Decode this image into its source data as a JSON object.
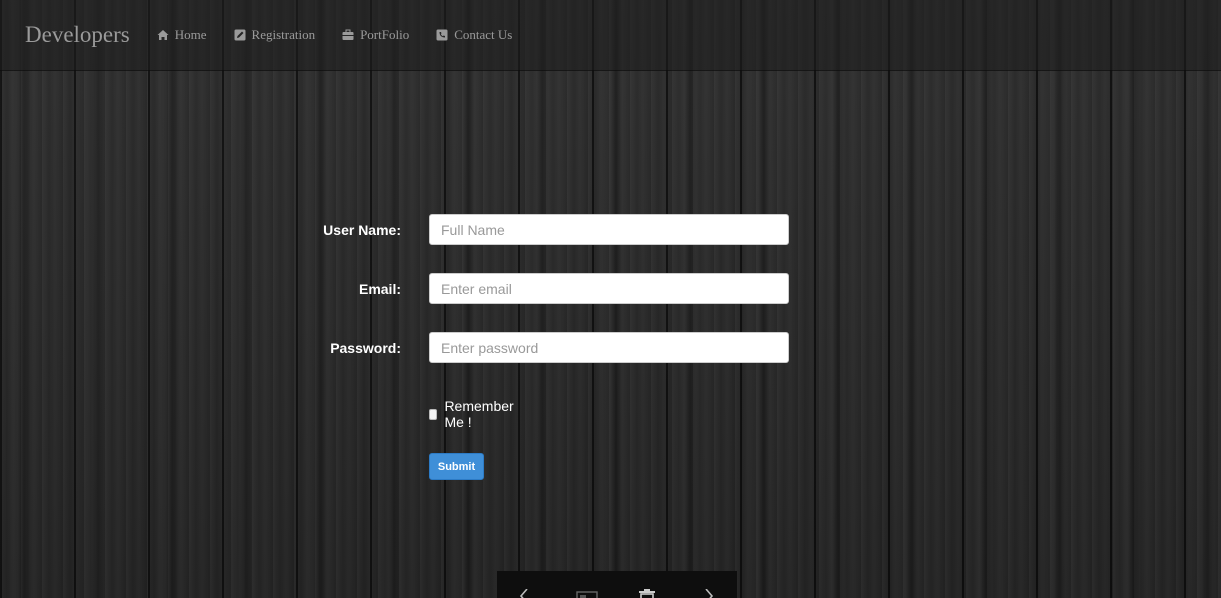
{
  "navbar": {
    "brand": "Developers",
    "items": [
      {
        "label": "Home",
        "icon": "home-icon"
      },
      {
        "label": "Registration",
        "icon": "edit-icon"
      },
      {
        "label": "PortFolio",
        "icon": "briefcase-icon"
      },
      {
        "label": "Contact Us",
        "icon": "phone-icon"
      }
    ]
  },
  "form": {
    "username": {
      "label": "User Name:",
      "placeholder": "Full Name",
      "value": ""
    },
    "email": {
      "label": "Email:",
      "placeholder": "Enter email",
      "value": ""
    },
    "password": {
      "label": "Password:",
      "placeholder": "Enter password",
      "value": ""
    },
    "remember": {
      "label": "Remember Me !",
      "checked": false
    },
    "submit_label": "Submit"
  },
  "viewer_toolbar": {
    "icons": [
      "chevron-left-icon",
      "image-icon",
      "trash-icon",
      "chevron-right-icon"
    ]
  },
  "colors": {
    "accent": "#3f8fd8",
    "nav_text": "#9a9a9a",
    "background": "#262626"
  }
}
